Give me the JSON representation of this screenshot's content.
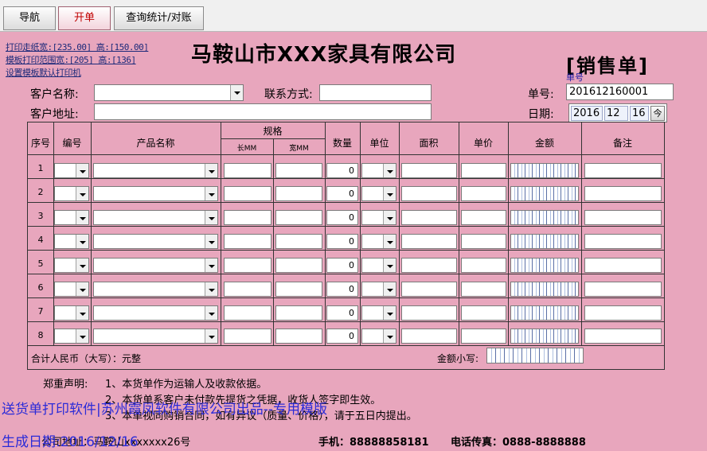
{
  "tabs": [
    {
      "label": "导航"
    },
    {
      "label": "开单"
    },
    {
      "label": "查询统计/对账"
    }
  ],
  "links": {
    "print_paper": "打印走纸宽:[235.00] 高:[150.00]",
    "template_range": "模板打印范围宽:[205] 高:[136]",
    "set_printer": "设置模板默认打印机"
  },
  "company": "马鞍山市XXX家具有限公司",
  "doc_title": "[销售单]",
  "doc_no_small": "单号",
  "header": {
    "customer_name_label": "客户名称:",
    "contact_label": "联系方式:",
    "address_label": "客户地址:",
    "order_no_label": "单号:",
    "order_no": "201612160001",
    "date_label": "日期:",
    "date_year": "2016",
    "date_month": "12",
    "date_day": "16",
    "date_btn": "今"
  },
  "columns": {
    "seq": "序号",
    "code": "编号",
    "product": "产品名称",
    "spec": "规格",
    "length": "长MM",
    "width": "宽MM",
    "qty": "数量",
    "unit": "单位",
    "area": "面积",
    "price": "单价",
    "amount": "金额",
    "note": "备注"
  },
  "rows": [
    {
      "no": "1",
      "qty": "0"
    },
    {
      "no": "2",
      "qty": "0"
    },
    {
      "no": "3",
      "qty": "0"
    },
    {
      "no": "4",
      "qty": "0"
    },
    {
      "no": "5",
      "qty": "0"
    },
    {
      "no": "6",
      "qty": "0"
    },
    {
      "no": "7",
      "qty": "0"
    },
    {
      "no": "8",
      "qty": "0"
    }
  ],
  "totals": {
    "rmb_caps": "合计人民币（大写）：元整",
    "amount_label": "金额小写:"
  },
  "declaration": {
    "title": "郑重声明:",
    "line1": "1、本货单作为运输人及收款依据。",
    "line2": "2、本货单系客户未付款先提货之凭据，收货人签字即生效。",
    "line3": "3、本单视同购销合同，如有异议（质量、价格），请于五日内提出。"
  },
  "watermark": {
    "line1": "送货单打印软件|苏州霞凤软件有限公司出品--专用模版",
    "line2": "生成日期:2016/12/16"
  },
  "footer": {
    "address": "公司地址：马鞍山xxxxxxx26号",
    "phone": "手机：88888858181",
    "tel_fax": "电话传真：0888-8888888"
  }
}
